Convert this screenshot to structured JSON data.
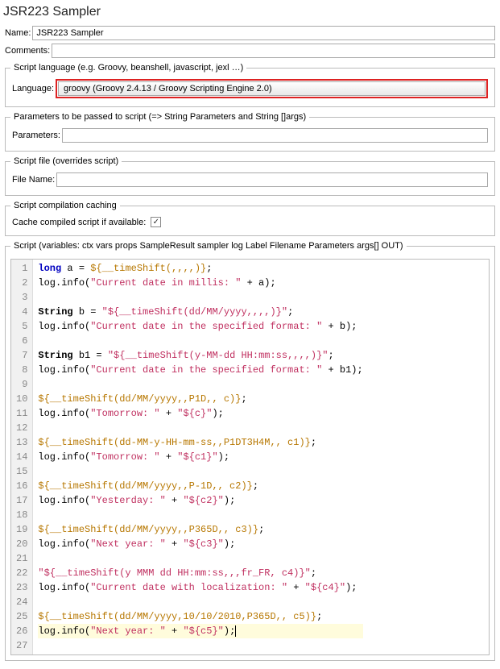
{
  "title": "JSR223 Sampler",
  "name_label": "Name:",
  "name_value": "JSR223 Sampler",
  "comments_label": "Comments:",
  "comments_value": "",
  "lang_fieldset_legend": "Script language (e.g. Groovy, beanshell, javascript, jexl …)",
  "lang_label": "Language:",
  "lang_value": "groovy     (Groovy 2.4.13 / Groovy Scripting Engine 2.0)",
  "params_legend": "Parameters to be passed to script (=> String Parameters and String []args)",
  "params_label": "Parameters:",
  "params_value": "",
  "file_legend": "Script file (overrides script)",
  "file_label": "File Name:",
  "file_value": "",
  "cache_legend": "Script compilation caching",
  "cache_label": "Cache compiled script if available:",
  "cache_checked": true,
  "script_legend": "Script (variables: ctx vars props SampleResult sampler log Label Filename Parameters args[] OUT)",
  "code_lines": [
    {
      "n": 1,
      "tokens": [
        {
          "t": "kw",
          "s": "long"
        },
        {
          "t": "p",
          "s": " a = "
        },
        {
          "t": "var",
          "s": "${__timeShift(,,,,)}"
        },
        {
          "t": "p",
          "s": ";"
        }
      ]
    },
    {
      "n": 2,
      "tokens": [
        {
          "t": "p",
          "s": "log.info("
        },
        {
          "t": "str",
          "s": "\"Current date in millis: \""
        },
        {
          "t": "p",
          "s": " + a);"
        }
      ]
    },
    {
      "n": 3,
      "tokens": []
    },
    {
      "n": 4,
      "tokens": [
        {
          "t": "type",
          "s": "String"
        },
        {
          "t": "p",
          "s": " b = "
        },
        {
          "t": "str",
          "s": "\"${__timeShift(dd/MM/yyyy,,,,)}\""
        },
        {
          "t": "p",
          "s": ";"
        }
      ]
    },
    {
      "n": 5,
      "tokens": [
        {
          "t": "p",
          "s": "log.info("
        },
        {
          "t": "str",
          "s": "\"Current date in the specified format: \""
        },
        {
          "t": "p",
          "s": " + b);"
        }
      ]
    },
    {
      "n": 6,
      "tokens": []
    },
    {
      "n": 7,
      "tokens": [
        {
          "t": "type",
          "s": "String"
        },
        {
          "t": "p",
          "s": " b1 = "
        },
        {
          "t": "str",
          "s": "\"${__timeShift(y-MM-dd HH:mm:ss,,,,)}\""
        },
        {
          "t": "p",
          "s": ";"
        }
      ]
    },
    {
      "n": 8,
      "tokens": [
        {
          "t": "p",
          "s": "log.info("
        },
        {
          "t": "str",
          "s": "\"Current date in the specified format: \""
        },
        {
          "t": "p",
          "s": " + b1);"
        }
      ]
    },
    {
      "n": 9,
      "tokens": []
    },
    {
      "n": 10,
      "tokens": [
        {
          "t": "var",
          "s": "${__timeShift(dd/MM/yyyy,,P1D,, c)}"
        },
        {
          "t": "p",
          "s": ";"
        }
      ]
    },
    {
      "n": 11,
      "tokens": [
        {
          "t": "p",
          "s": "log.info("
        },
        {
          "t": "str",
          "s": "\"Tomorrow: \""
        },
        {
          "t": "p",
          "s": " + "
        },
        {
          "t": "str",
          "s": "\"${c}\""
        },
        {
          "t": "p",
          "s": ");"
        }
      ]
    },
    {
      "n": 12,
      "tokens": []
    },
    {
      "n": 13,
      "tokens": [
        {
          "t": "var",
          "s": "${__timeShift(dd-MM-y-HH-mm-ss,,P1DT3H4M,, c1)}"
        },
        {
          "t": "p",
          "s": ";"
        }
      ]
    },
    {
      "n": 14,
      "tokens": [
        {
          "t": "p",
          "s": "log.info("
        },
        {
          "t": "str",
          "s": "\"Tomorrow: \""
        },
        {
          "t": "p",
          "s": " + "
        },
        {
          "t": "str",
          "s": "\"${c1}\""
        },
        {
          "t": "p",
          "s": ");"
        }
      ]
    },
    {
      "n": 15,
      "tokens": []
    },
    {
      "n": 16,
      "tokens": [
        {
          "t": "var",
          "s": "${__timeShift(dd/MM/yyyy,,P-1D,, c2)}"
        },
        {
          "t": "p",
          "s": ";"
        }
      ]
    },
    {
      "n": 17,
      "tokens": [
        {
          "t": "p",
          "s": "log.info("
        },
        {
          "t": "str",
          "s": "\"Yesterday: \""
        },
        {
          "t": "p",
          "s": " + "
        },
        {
          "t": "str",
          "s": "\"${c2}\""
        },
        {
          "t": "p",
          "s": ");"
        }
      ]
    },
    {
      "n": 18,
      "tokens": []
    },
    {
      "n": 19,
      "tokens": [
        {
          "t": "var",
          "s": "${__timeShift(dd/MM/yyyy,,P365D,, c3)}"
        },
        {
          "t": "p",
          "s": ";"
        }
      ]
    },
    {
      "n": 20,
      "tokens": [
        {
          "t": "p",
          "s": "log.info("
        },
        {
          "t": "str",
          "s": "\"Next year: \""
        },
        {
          "t": "p",
          "s": " + "
        },
        {
          "t": "str",
          "s": "\"${c3}\""
        },
        {
          "t": "p",
          "s": ");"
        }
      ]
    },
    {
      "n": 21,
      "tokens": []
    },
    {
      "n": 22,
      "tokens": [
        {
          "t": "str",
          "s": "\"${__timeShift(y MMM dd HH:mm:ss,,,fr_FR, c4)}\""
        },
        {
          "t": "p",
          "s": ";"
        }
      ]
    },
    {
      "n": 23,
      "tokens": [
        {
          "t": "p",
          "s": "log.info("
        },
        {
          "t": "str",
          "s": "\"Current date with localization: \""
        },
        {
          "t": "p",
          "s": " + "
        },
        {
          "t": "str",
          "s": "\"${c4}\""
        },
        {
          "t": "p",
          "s": ");"
        }
      ]
    },
    {
      "n": 24,
      "tokens": []
    },
    {
      "n": 25,
      "tokens": [
        {
          "t": "var",
          "s": "${__timeShift(dd/MM/yyyy,10/10/2010,P365D,, c5)}"
        },
        {
          "t": "p",
          "s": ";"
        }
      ]
    },
    {
      "n": 26,
      "hl": true,
      "tokens": [
        {
          "t": "p",
          "s": "log.info("
        },
        {
          "t": "str",
          "s": "\"Next year: \""
        },
        {
          "t": "p",
          "s": " + "
        },
        {
          "t": "str",
          "s": "\"${c5}\""
        },
        {
          "t": "p",
          "s": ");"
        },
        {
          "t": "cursor",
          "s": ""
        }
      ]
    },
    {
      "n": 27,
      "tokens": []
    }
  ]
}
